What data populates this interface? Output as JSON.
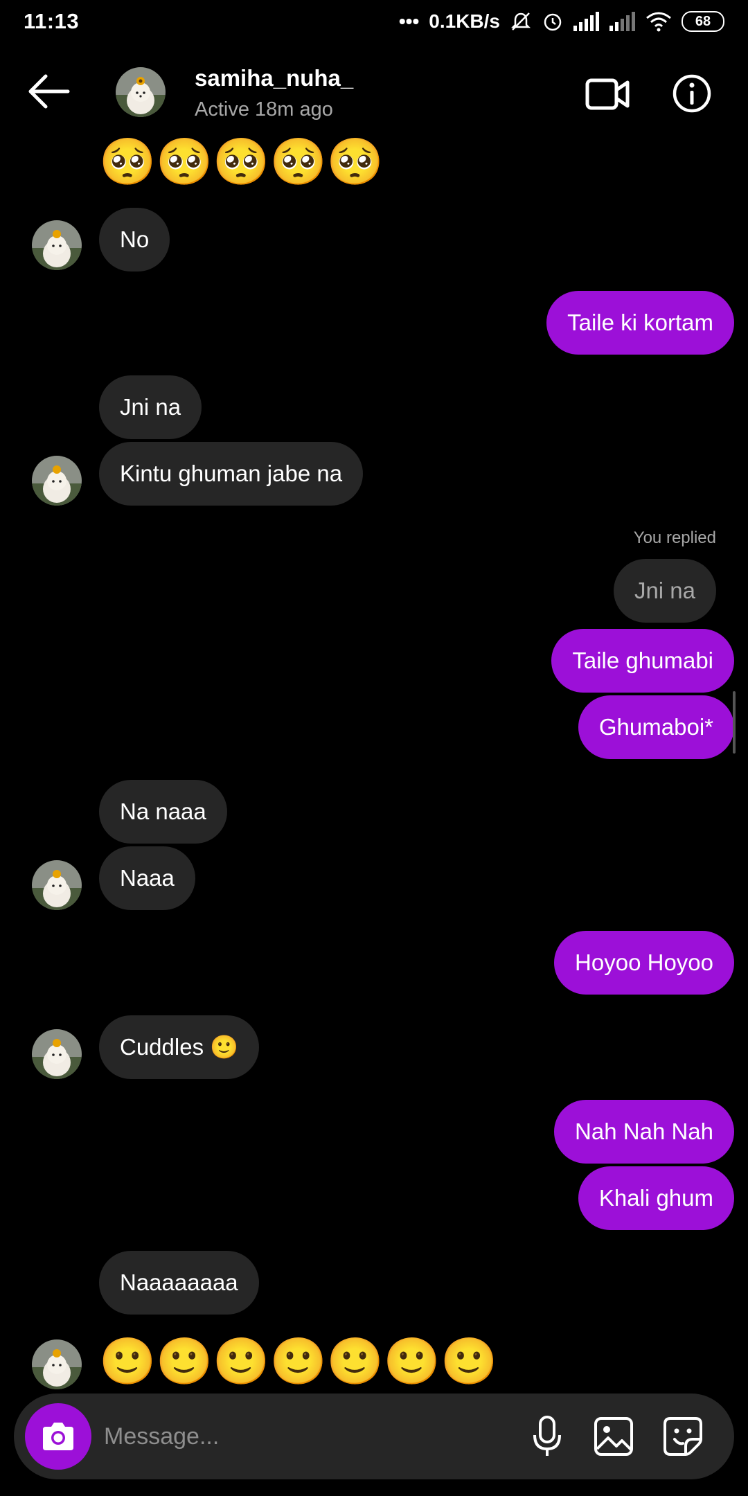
{
  "status_bar": {
    "time": "11:13",
    "net_speed": "0.1KB/s",
    "battery": "68"
  },
  "header": {
    "username": "samiha_nuha_",
    "status": "Active 18m ago"
  },
  "messages": [
    {
      "side": "in",
      "text": "No"
    },
    {
      "side": "out",
      "text": "Taile ki kortam"
    },
    {
      "side": "in",
      "text": "Jni na"
    },
    {
      "side": "in",
      "text": "Kintu ghuman jabe na"
    },
    {
      "side": "reply",
      "label": "You replied",
      "text": "Jni na"
    },
    {
      "side": "out",
      "text": "Taile ghumabi"
    },
    {
      "side": "out",
      "text": "Ghumaboi*"
    },
    {
      "side": "in",
      "text": "Na naaa"
    },
    {
      "side": "in",
      "text": "Naaa"
    },
    {
      "side": "out",
      "text": "Hoyoo Hoyoo"
    },
    {
      "side": "in",
      "text": "Cuddles 🙂"
    },
    {
      "side": "out",
      "text": "Nah Nah Nah"
    },
    {
      "side": "out",
      "text": "Khali ghum"
    },
    {
      "side": "in",
      "text": "Naaaaaaaa"
    }
  ],
  "emoji_top": "🥺🥺🥺🥺🥺",
  "emoji_bottom": "🙂🙂🙂🙂🙂🙂🙂",
  "composer": {
    "placeholder": "Message..."
  }
}
